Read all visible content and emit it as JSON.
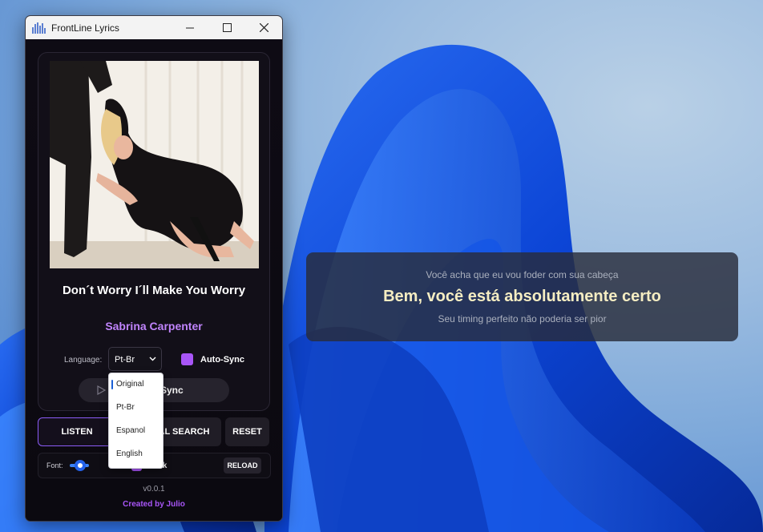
{
  "window": {
    "title": "FrontLine Lyrics"
  },
  "track": {
    "title": "Don´t Worry I´ll Make You Worry",
    "artist": "Sabrina Carpenter"
  },
  "controls": {
    "language_label": "Language:",
    "language_value": "Pt-Br",
    "language_options": [
      "Original",
      "Pt-Br",
      "Espanol",
      "English"
    ],
    "language_highlighted": "Original",
    "autosync_label": "Auto-Sync",
    "manual_sync_label": "Manual Sync"
  },
  "actions": {
    "listen": "LISTEN",
    "manual_search": "MANUAL SEARCH",
    "reset": "RESET"
  },
  "bottom": {
    "font_label": "Font:",
    "lock_label": "Lock",
    "reload": "RELOAD"
  },
  "footer": {
    "version": "v0.0.1",
    "credit": "Created by Julio"
  },
  "lyrics": {
    "previous": "Você acha que eu vou foder com sua cabeça",
    "current": "Bem, você está absolutamente certo",
    "next": "Seu timing perfeito não poderia ser pior"
  },
  "colors": {
    "accent": "#a855f7",
    "artist": "#c084fc",
    "lyric_current": "#f5edc2"
  }
}
